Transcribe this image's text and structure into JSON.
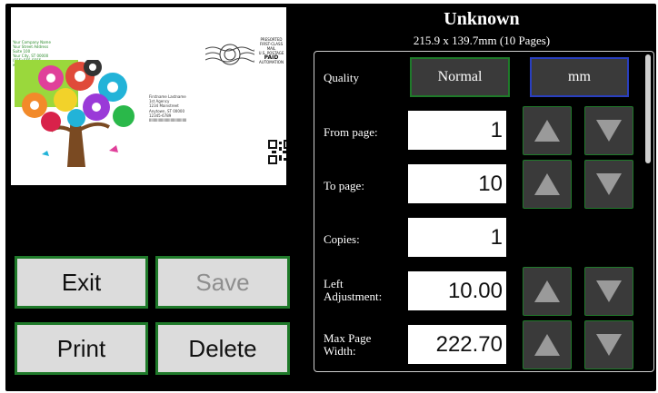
{
  "preview": {
    "return_address": [
      "Your Company Name",
      "Your Street Address",
      "Suite 100",
      "Your City, ST 00000",
      "(555) 555-5555",
      "www.website.com"
    ],
    "postage": [
      "PRESORTED",
      "FIRST-CLASS MAIL",
      "U.S. POSTAGE",
      "PAID",
      "AUTOMATION"
    ],
    "recipient": [
      "Firstname Lastname",
      "1st Agency",
      "1234 Mainstreet",
      "Anytown, ST 00000",
      "12345-6789",
      "IIIIIIIIIIIIIIIIIIIIIIIIIIIIIIIIIII"
    ]
  },
  "header": {
    "title": "Unknown",
    "subtitle": "215.9 x 139.7mm (10 Pages)"
  },
  "buttons": {
    "exit": "Exit",
    "save": "Save",
    "print": "Print",
    "delete": "Delete"
  },
  "settings": {
    "quality_label": "Quality",
    "quality_value": "Normal",
    "units_value": "mm",
    "from_page_label": "From page:",
    "from_page_value": "1",
    "to_page_label": "To page:",
    "to_page_value": "10",
    "copies_label": "Copies:",
    "copies_value": "1",
    "left_adj_label_1": "Left",
    "left_adj_label_2": "Adjustment:",
    "left_adj_value": "10.00",
    "max_width_label_1": "Max Page",
    "max_width_label_2": "Width:",
    "max_width_value": "222.70"
  },
  "colors": {
    "background": "#000000",
    "button_border": "#1f7a2a",
    "units_border": "#2a3fbf",
    "button_face": "#dcdcdc",
    "arrow_face": "#3a3a3a"
  }
}
